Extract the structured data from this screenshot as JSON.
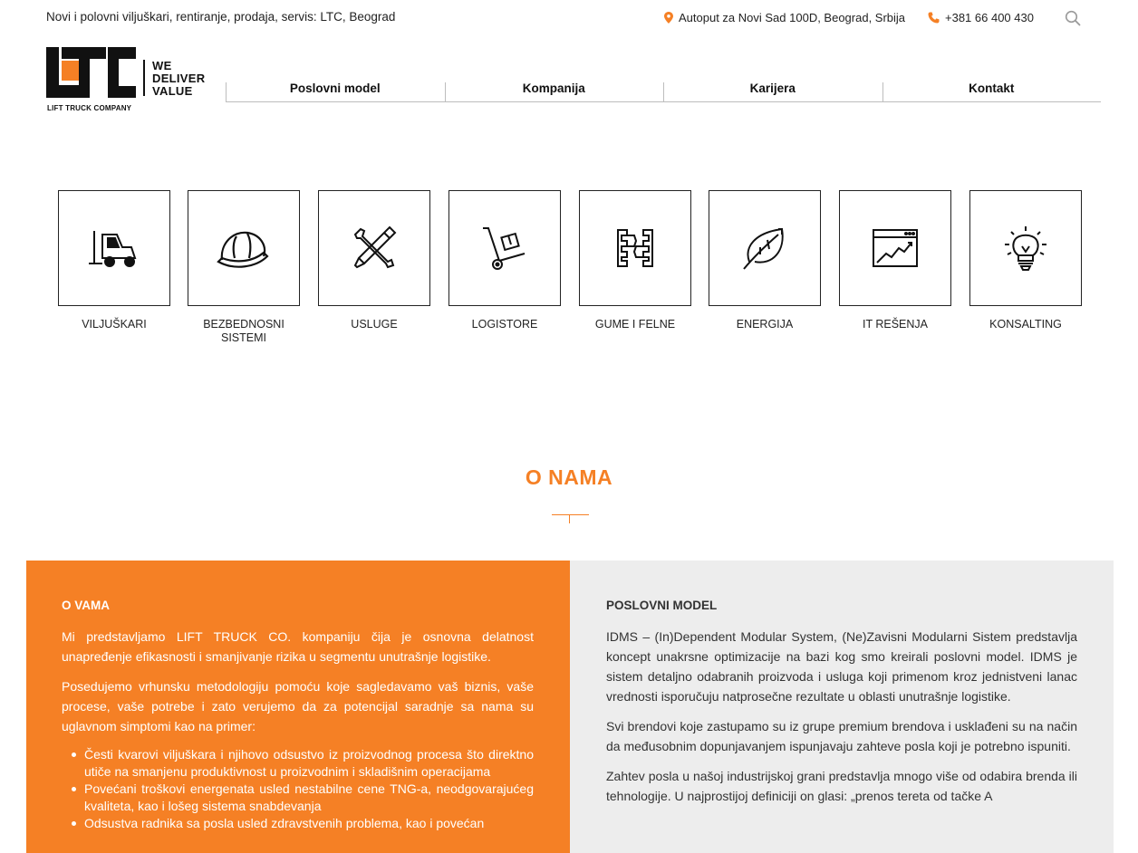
{
  "topbar": {
    "tagline": "Novi i polovni viljuškari, rentiranje, prodaja, servis: LTC, Beograd",
    "address": "Autoput za Novi Sad 100D, Beograd, Srbija",
    "phone": "+381 66 400 430",
    "icons": {
      "address": "map-pin-icon",
      "phone": "phone-icon",
      "search": "search-icon"
    },
    "accent_color": "#f58025"
  },
  "logo": {
    "letters": "LTC",
    "caption": "LIFT TRUCK COMPANY",
    "slogan_line1": "WE",
    "slogan_line2": "DELIVER",
    "slogan_line3": "VALUE"
  },
  "nav": {
    "items": [
      {
        "label": "Poslovni model"
      },
      {
        "label": "Kompanija"
      },
      {
        "label": "Karijera"
      },
      {
        "label": "Kontakt"
      }
    ]
  },
  "tiles": [
    {
      "label": "VILJUŠKARI",
      "icon": "forklift-icon"
    },
    {
      "label": "BEZBEDNOSNI SISTEMI",
      "icon": "hard-hat-icon"
    },
    {
      "label": "USLUGE",
      "icon": "tools-icon"
    },
    {
      "label": "LOGISTORE",
      "icon": "hand-truck-icon"
    },
    {
      "label": "GUME I FELNE",
      "icon": "tire-tread-icon"
    },
    {
      "label": "ENERGIJA",
      "icon": "leaf-icon"
    },
    {
      "label": "IT REŠENJA",
      "icon": "browser-chart-icon"
    },
    {
      "label": "KONSALTING",
      "icon": "lightbulb-icon"
    }
  ],
  "about": {
    "title": "O NAMA",
    "left": {
      "heading": "O VAMA",
      "p1": "Mi predstavljamo LIFT TRUCK CO. kompaniju čija je osnovna delatnost unapređenje efikasnosti i smanjivanje rizika u segmentu unutrašnje logistike.",
      "p2": "Posedujemo vrhunsku metodologiju pomoću koje sagledavamo vaš biznis, vaše procese, vaše potrebe i zato verujemo da za potencijal saradnje sa nama su uglavnom simptomi kao na primer:",
      "bullets": [
        "Česti kvarovi viljuškara i njihovo odsustvo iz proizvodnog procesa što direktno utiče na smanjenu produktivnost u proizvodnim i skladišnim operacijama",
        "Povećani troškovi energenata usled nestabilne cene TNG-a, neodgovarajućeg kvaliteta, kao i lošeg sistema snabdevanja",
        "Odsustva radnika sa posla usled zdravstvenih problema, kao i povećan"
      ]
    },
    "right": {
      "heading": "POSLOVNI MODEL",
      "p1": "IDMS – (In)Dependent Modular System, (Ne)Zavisni Modularni Sistem predstavlja koncept unakrsne optimizacije na bazi kog smo kreirali poslovni model. IDMS je sistem detaljno odabranih proizvoda i usluga koji primenom kroz jednistveni lanac vrednosti isporučuju natprosečne rezultate u oblasti unutrašnje logistike.",
      "p2": "Svi brendovi koje zastupamo su iz grupe premium brendova i usklađeni su na način da međusobnim dopunjavanjem ispunjavaju zahteve posla koji je potrebno ispuniti.",
      "p3": "Zahtev posla u našoj industrijskoj grani predstavlja mnogo više od odabira brenda ili tehnologije. U najprostijoj definiciji on glasi: „prenos tereta od tačke A"
    }
  }
}
